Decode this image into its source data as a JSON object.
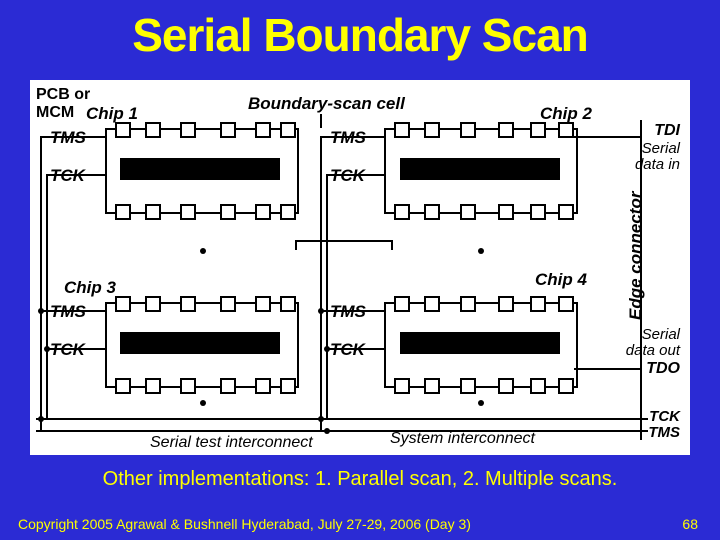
{
  "title": "Serial Boundary Scan",
  "caption": "Other implementations: 1. Parallel scan, 2. Multiple scans.",
  "footer_left": "Copyright 2005 Agrawal & Bushnell   Hyderabad, July 27-29, 2006 (Day 3)",
  "footer_right": "68",
  "labels": {
    "pcb": "PCB or",
    "mcm": "MCM",
    "chip1": "Chip 1",
    "chip2": "Chip 2",
    "chip3": "Chip 3",
    "chip4": "Chip 4",
    "bscell": "Boundary-scan cell",
    "tms1": "TMS",
    "tms2": "TMS",
    "tms3": "TMS",
    "tms4": "TMS",
    "tck1": "TCK",
    "tck2": "TCK",
    "tck3": "TCK",
    "tck4": "TCK",
    "tdi": "TDI",
    "sdi1": "Serial",
    "sdi2": "data in",
    "sdo1": "Serial",
    "sdo2": "data out",
    "tdo": "TDO",
    "tck_r": "TCK",
    "tms_r": "TMS",
    "edge": "Edge connector",
    "serial_int": "Serial test interconnect",
    "system_int": "System interconnect"
  }
}
